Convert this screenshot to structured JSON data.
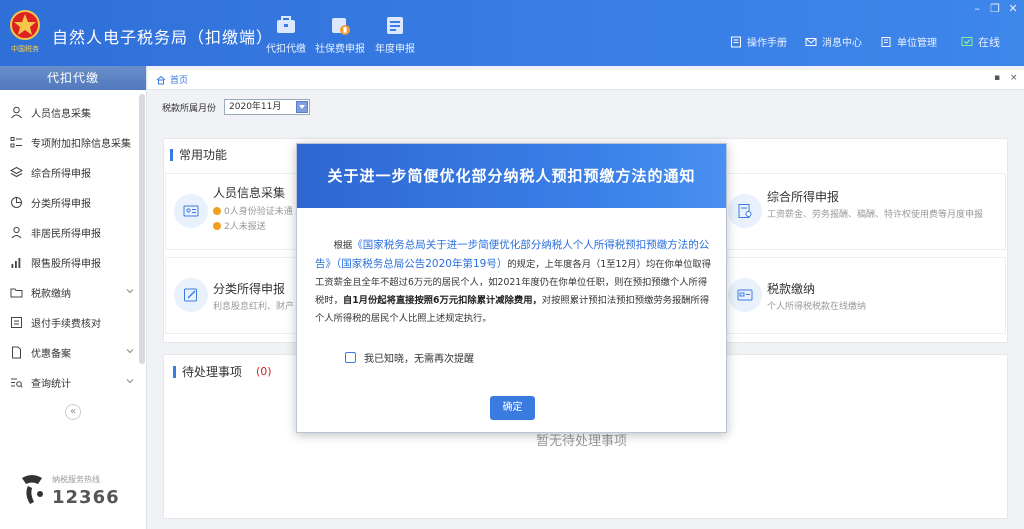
{
  "app": {
    "title": "自然人电子税务局（扣缴端）",
    "logo_text": "中国税务"
  },
  "top_tools": [
    {
      "label": "代扣代缴",
      "icon": "briefcase-icon"
    },
    {
      "label": "社保费申报",
      "icon": "social-security-icon"
    },
    {
      "label": "年度申报",
      "icon": "annual-report-icon"
    }
  ],
  "right_tools": [
    {
      "label": "操作手册",
      "icon": "manual-icon"
    },
    {
      "label": "消息中心",
      "icon": "mail-icon"
    },
    {
      "label": "单位管理",
      "icon": "building-icon"
    },
    {
      "label": "在线",
      "icon": "online-icon"
    }
  ],
  "window_controls": {
    "minimize": "–",
    "restore": "❐",
    "close": "✕"
  },
  "sidebar": {
    "header": "代扣代缴",
    "items": [
      {
        "label": "人员信息采集",
        "icon": "person-icon",
        "expandable": false
      },
      {
        "label": "专项附加扣除信息采集",
        "icon": "list-icon",
        "expandable": false
      },
      {
        "label": "综合所得申报",
        "icon": "layers-icon",
        "expandable": false
      },
      {
        "label": "分类所得申报",
        "icon": "pie-icon",
        "expandable": false
      },
      {
        "label": "非居民所得申报",
        "icon": "user-outline-icon",
        "expandable": false
      },
      {
        "label": "限售股所得申报",
        "icon": "bar-chart-icon",
        "expandable": false
      },
      {
        "label": "税款缴纳",
        "icon": "folder-icon",
        "expandable": true
      },
      {
        "label": "退付手续费核对",
        "icon": "checklist-icon",
        "expandable": false
      },
      {
        "label": "优惠备案",
        "icon": "document-icon",
        "expandable": true
      },
      {
        "label": "查询统计",
        "icon": "query-icon",
        "expandable": true
      }
    ],
    "collapse_glyph": "«",
    "hotline_label": "纳税服务热线",
    "hotline_number": "12366"
  },
  "tabs": {
    "home": "首页",
    "restore": "▪",
    "close": "×"
  },
  "period": {
    "label": "税款所属月份",
    "value": "2020年11月"
  },
  "common": {
    "title": "常用功能",
    "tiles": [
      {
        "name": "人员信息采集",
        "lines": [
          "0人身份验证未通",
          "2人未报送"
        ]
      },
      {
        "name": "综合所得申报",
        "desc": "工资薪金、劳务报酬、稿酬、特许权使用费等月度申报"
      },
      {
        "name": "分类所得申报",
        "desc": "利息股息红利、财产"
      },
      {
        "name": "税款缴纳",
        "desc": "个人所得税税款在线缴纳"
      }
    ]
  },
  "pending": {
    "title": "待处理事项",
    "count": "(0)",
    "empty": "暂无待处理事项"
  },
  "modal": {
    "title": "关于进一步简便优化部分纳税人预扣预缴方法的通知",
    "p_prefix": "根据",
    "p_link": "《国家税务总局关于进一步简便优化部分纳税人个人所得税预扣预缴方法的公告》（国家税务总局公告2020年第19号）",
    "p_mid": "的规定，上年度各月（1至12月）均在你单位取得工资薪金且全年不超过6万元的居民个人，如2021年度仍在你单位任职，则在预扣预缴个人所得税时，",
    "p_bold": "自1月份起将直接按照6万元扣除累计减除费用，",
    "p_suffix": "对按照累计预扣法预扣预缴劳务报酬所得个人所得税的居民个人比照上述规定执行。",
    "checkbox_label": "我已知晓，无需再次提醒",
    "ok_label": "确定"
  },
  "colors": {
    "primary": "#3a7be0",
    "header": "#3a7ee6",
    "warning": "#f0a020",
    "danger": "#e02020"
  }
}
